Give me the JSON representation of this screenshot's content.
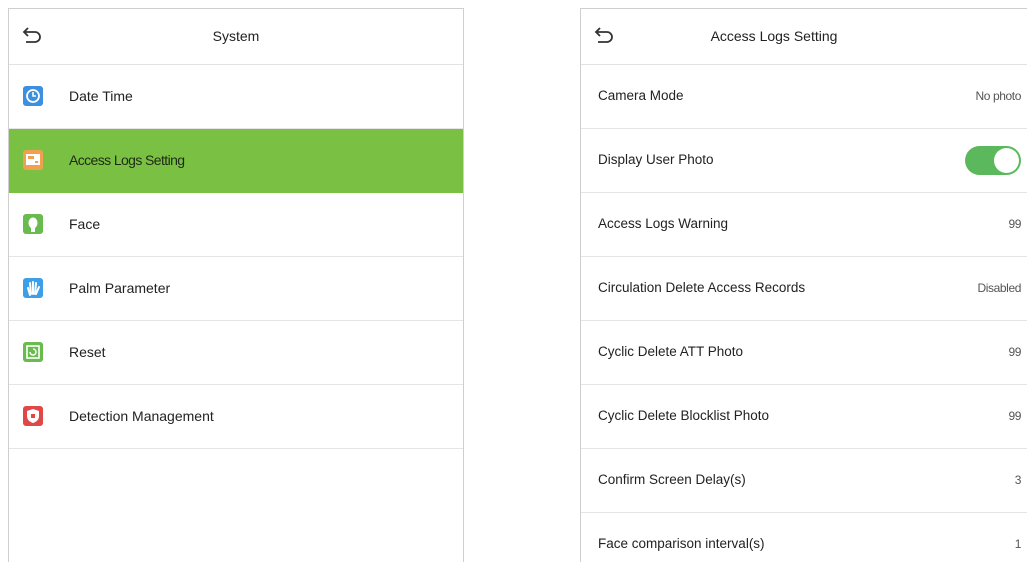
{
  "system": {
    "title": "System",
    "items": [
      {
        "label": "Date Time",
        "icon": "clock-icon",
        "color": "#3d8fe0"
      },
      {
        "label": "Access Logs Setting",
        "icon": "access-logs-icon",
        "color": "#f0a050",
        "selected": true
      },
      {
        "label": "Face",
        "icon": "face-icon",
        "color": "#6abb4e"
      },
      {
        "label": "Palm Parameter",
        "icon": "palm-icon",
        "color": "#3d9fe8"
      },
      {
        "label": "Reset",
        "icon": "reset-icon",
        "color": "#6abb4e"
      },
      {
        "label": "Detection Management",
        "icon": "shield-icon",
        "color": "#e04848"
      }
    ]
  },
  "access_logs": {
    "title": "Access Logs Setting",
    "rows": [
      {
        "label": "Camera Mode",
        "value": "No photo"
      },
      {
        "label": "Display User Photo",
        "toggle": true
      },
      {
        "label": "Access Logs Warning",
        "value": "99"
      },
      {
        "label": "Circulation Delete Access Records",
        "value": "Disabled"
      },
      {
        "label": "Cyclic Delete ATT Photo",
        "value": "99"
      },
      {
        "label": "Cyclic Delete Blocklist Photo",
        "value": "99"
      },
      {
        "label": "Confirm Screen Delay(s)",
        "value": "3"
      },
      {
        "label": "Face comparison interval(s)",
        "value": "1"
      }
    ]
  },
  "colors": {
    "selected_bg": "#7ac143",
    "toggle_on": "#5cb85c"
  }
}
